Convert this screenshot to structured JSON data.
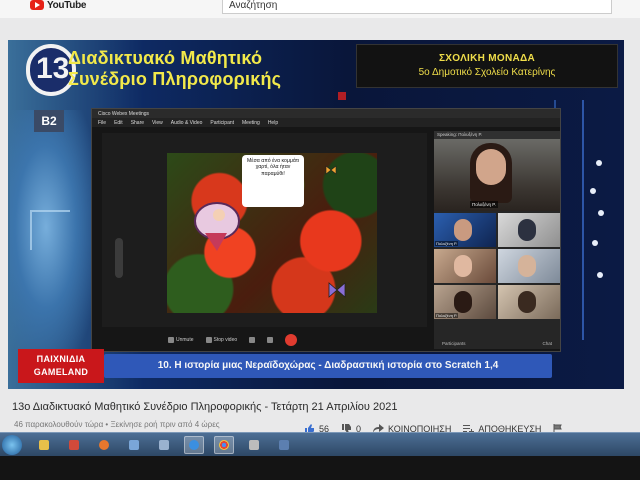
{
  "youtube": {
    "logo_text": "YouTube",
    "search_value": "Αναζήτηση"
  },
  "video": {
    "conference_title_line1": "Διαδικτυακό Μαθητικό",
    "conference_title_line2": "Συνέδριο Πληροφορικής",
    "logo_number": "13",
    "school_label": "ΣΧΟΛΙΚΗ ΜΟΝΑΔΑ",
    "school_name": "5ο Δημοτικό Σχολείο Κατερίνης",
    "room_badge": "Β2",
    "category_line1": "ΠΑΙΧΝΙΔΙΑ",
    "category_line2": "GAMELAND",
    "session_title": "10. Η ιστορία μιας Νεραϊδοχώρας - Διαδραστική ιστορία στο Scratch 1,4"
  },
  "webex": {
    "window_title": "Cisco Webex Meetings",
    "menu_items": [
      "File",
      "Edit",
      "Share",
      "View",
      "Audio & Video",
      "Participant",
      "Meeting",
      "Help"
    ],
    "speech_bubble": "Μέσα από ένα κομμάτι χαρτί, όλα ήταν παραμύθι!",
    "speaking_label": "Speaking: Πολυξένη Ρ.",
    "speaker_name": "Πολυξένη Ρ.",
    "tile_captions": [
      "Πολυξένη Ρ.",
      "",
      "",
      "",
      "Πολυξένη Ρ.",
      ""
    ],
    "controls": [
      "Unmute",
      "Stop video",
      "",
      ""
    ],
    "panel_footer_left": "Participants",
    "panel_footer_right": "Chat"
  },
  "below": {
    "video_title": "13ο Διαδικτυακό Μαθητικό Συνέδριο Πληροφορικής - Τετάρτη 21 Απριλίου 2021",
    "meta": "46 παρακολουθούν τώρα • Ξεκίνησε ροή πριν από 4 ώρες",
    "likes": "56",
    "dislikes": "0",
    "share_label": "ΚΟΙΝΟΠΟΙΗΣΗ",
    "save_label": "ΑΠΟΘΗΚΕΥΣΗ"
  },
  "colors": {
    "title_yellow": "#f2e94a",
    "session_blue": "#2f58b8",
    "games_red": "#c9171b",
    "youtube_red": "#e62117"
  },
  "icons": [
    "youtube-logo-icon",
    "like-icon",
    "dislike-icon",
    "share-icon",
    "save-icon",
    "flag-icon",
    "windows-start-icon"
  ]
}
